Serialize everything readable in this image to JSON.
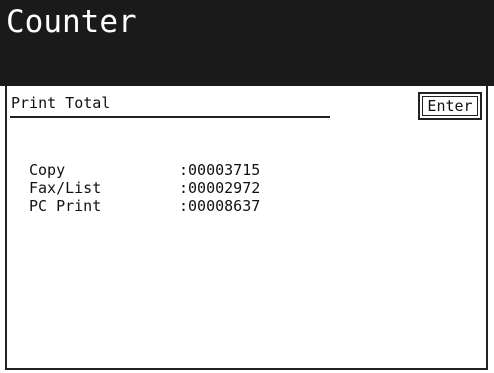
{
  "header": {
    "title": "Counter"
  },
  "panel": {
    "section_title": "Print Total",
    "enter_label": "Enter"
  },
  "counters": [
    {
      "label": "Copy",
      "value": ":00003715"
    },
    {
      "label": "Fax/List",
      "value": ":00002972"
    },
    {
      "label": "PC Print",
      "value": ":00008637"
    }
  ],
  "colors": {
    "title_bar": "#1a1a1a",
    "title_text": "#ffffff",
    "background": "#ffffff",
    "border": "#222222"
  }
}
